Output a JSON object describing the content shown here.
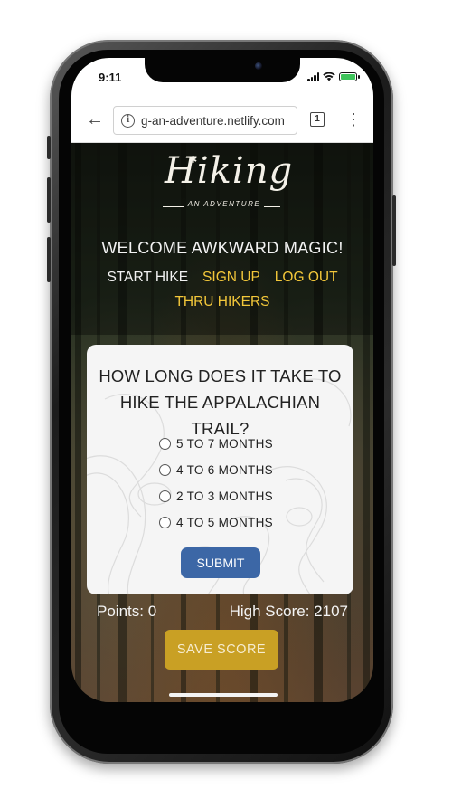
{
  "status_bar": {
    "time": "9:11",
    "icons": [
      "cellular-signal-icon",
      "wifi-icon",
      "battery-charging-icon"
    ],
    "battery_color": "#3ec45b"
  },
  "browser": {
    "url": "g-an-adventure.netlify.com",
    "tab_count": "1",
    "icons": [
      "back-arrow-icon",
      "info-icon",
      "tabs-icon",
      "overflow-menu-icon"
    ]
  },
  "app": {
    "logo_word": "Hiking",
    "logo_subtitle": "AN ADVENTURE",
    "welcome": "WELCOME AWKWARD MAGIC!",
    "nav": {
      "start_hike": "START HIKE",
      "sign_up": "SIGN UP",
      "log_out": "LOG OUT",
      "thru_hikers": "THRU HIKERS"
    },
    "quiz": {
      "question": "HOW LONG DOES IT TAKE TO HIKE THE APPALACHIAN TRAIL?",
      "options": [
        "5 TO 7 MONTHS",
        "4 TO 6 MONTHS",
        "2 TO 3 MONTHS",
        "4 TO 5 MONTHS"
      ],
      "submit_label": "SUBMIT"
    },
    "points_label": "Points: 0",
    "high_score_label": "High Score: 2107",
    "save_label": "SAVE SCORE"
  },
  "colors": {
    "accent_gold": "#f3c73a",
    "submit_blue": "#3c67a6",
    "save_gold": "#c9a024"
  }
}
